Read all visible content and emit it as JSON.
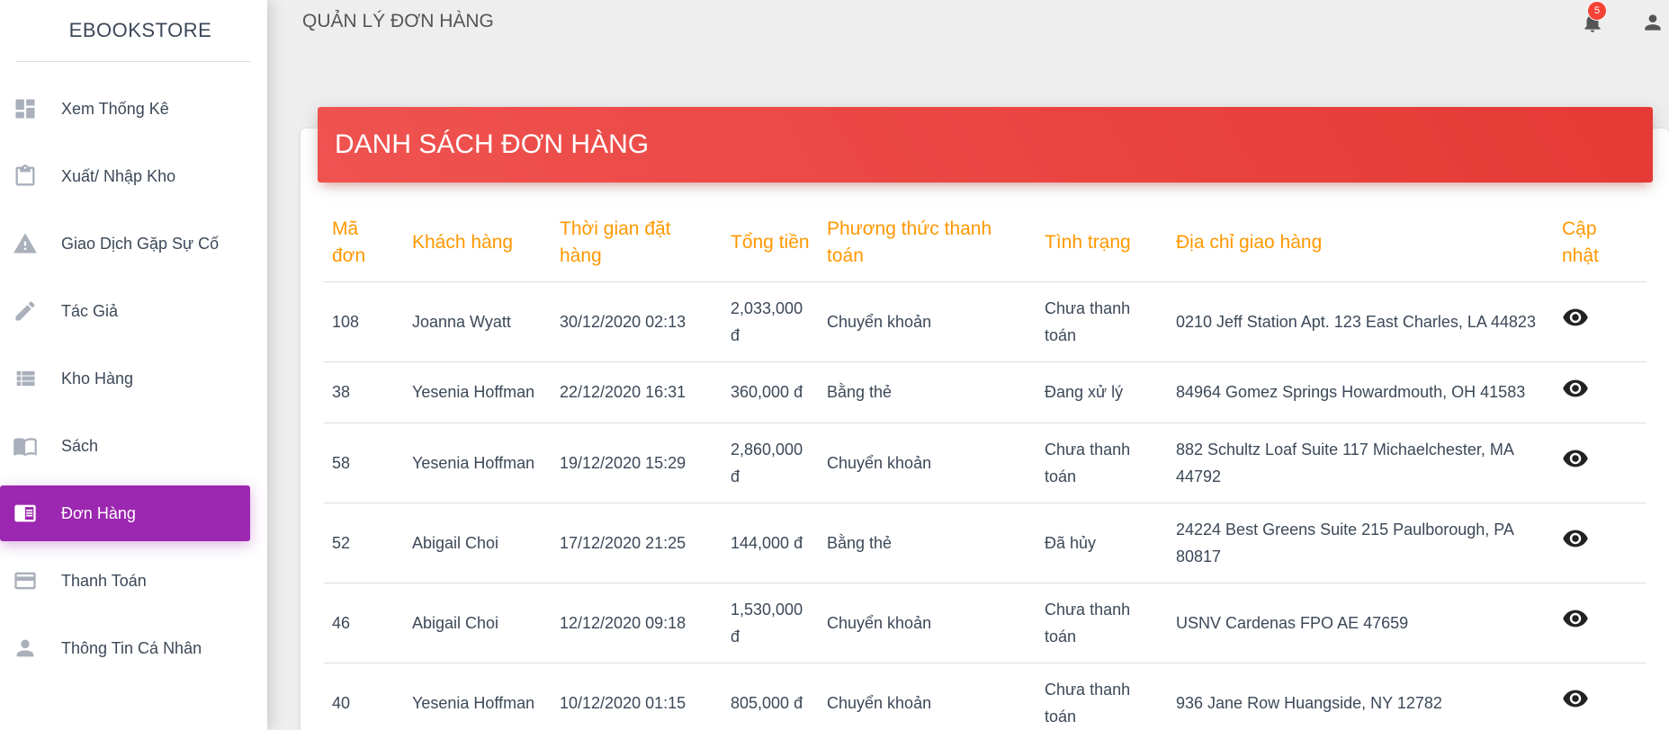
{
  "sidebar": {
    "brand": "EBOOKSTORE",
    "items": [
      {
        "label": "Xem Thống Kê",
        "icon": "dashboard-icon"
      },
      {
        "label": "Xuất/ Nhập Kho",
        "icon": "clipboard-icon"
      },
      {
        "label": "Giao Dịch Gặp Sự Cố",
        "icon": "warning-icon"
      },
      {
        "label": "Tác Giả",
        "icon": "pencil-icon"
      },
      {
        "label": "Kho Hàng",
        "icon": "list-icon"
      },
      {
        "label": "Sách",
        "icon": "book-icon"
      },
      {
        "label": "Đơn Hàng",
        "icon": "receipt-icon",
        "active": true
      },
      {
        "label": "Thanh Toán",
        "icon": "credit-card-icon"
      },
      {
        "label": "Thông Tin Cá Nhân",
        "icon": "person-icon"
      }
    ]
  },
  "header": {
    "title": "QUẢN LÝ ĐƠN HÀNG",
    "notification_count": "5",
    "icons": [
      "bell-icon",
      "person-icon"
    ]
  },
  "card": {
    "title": "DANH SÁCH ĐƠN HÀNG"
  },
  "table": {
    "columns": [
      "Mã đơn",
      "Khách hàng",
      "Thời gian đặt hàng",
      "Tổng tiền",
      "Phương thức thanh toán",
      "Tình trạng",
      "Địa chỉ giao hàng",
      "Cập nhật"
    ],
    "rows": [
      {
        "id": "108",
        "customer": "Joanna Wyatt",
        "time": "30/12/2020 02:13",
        "total": "2,033,000 đ",
        "method": "Chuyển khoản",
        "status": "Chưa thanh toán",
        "address": "0210 Jeff Station Apt. 123 East Charles, LA 44823"
      },
      {
        "id": "38",
        "customer": "Yesenia Hoffman",
        "time": "22/12/2020 16:31",
        "total": "360,000 đ",
        "method": "Bằng thẻ",
        "status": "Đang xử lý",
        "address": "84964 Gomez Springs Howardmouth, OH 41583"
      },
      {
        "id": "58",
        "customer": "Yesenia Hoffman",
        "time": "19/12/2020 15:29",
        "total": "2,860,000 đ",
        "method": "Chuyển khoản",
        "status": "Chưa thanh toán",
        "address": "882 Schultz Loaf Suite 117 Michaelchester, MA 44792"
      },
      {
        "id": "52",
        "customer": "Abigail Choi",
        "time": "17/12/2020 21:25",
        "total": "144,000 đ",
        "method": "Bằng thẻ",
        "status": "Đã hủy",
        "address": "24224 Best Greens Suite 215 Paulborough, PA 80817"
      },
      {
        "id": "46",
        "customer": "Abigail Choi",
        "time": "12/12/2020 09:18",
        "total": "1,530,000 đ",
        "method": "Chuyển khoản",
        "status": "Chưa thanh toán",
        "address": "USNV Cardenas FPO AE 47659"
      },
      {
        "id": "40",
        "customer": "Yesenia Hoffman",
        "time": "10/12/2020 01:15",
        "total": "805,000 đ",
        "method": "Chuyển khoản",
        "status": "Chưa thanh toán",
        "address": "936 Jane Row Huangside, NY 12782"
      }
    ]
  },
  "colors": {
    "accent_header": "#e53935",
    "active_nav": "#9c27b0",
    "table_header_text": "#ff9800",
    "badge": "#f44336"
  }
}
